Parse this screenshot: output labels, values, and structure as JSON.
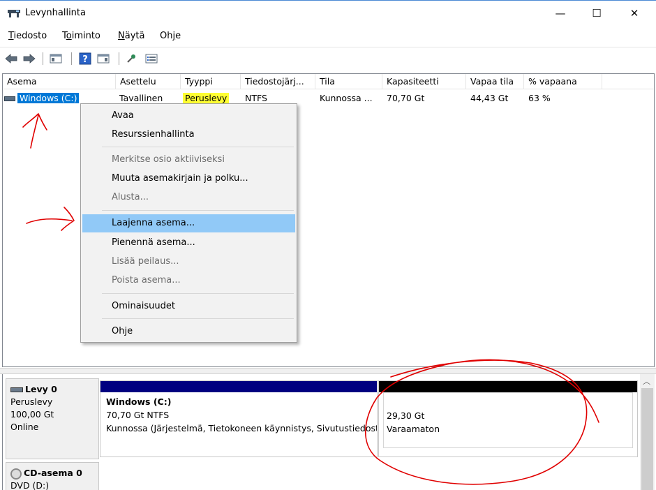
{
  "window": {
    "title": "Levynhallinta",
    "controls": {
      "minimize": "—",
      "maximize": "☐",
      "close": "✕"
    }
  },
  "menu": [
    {
      "label": "Tiedosto",
      "mnemonic_index": 0
    },
    {
      "label": "Toiminto",
      "mnemonic_index": 1
    },
    {
      "label": "Näytä",
      "mnemonic_index": 0
    },
    {
      "label": "Ohje",
      "mnemonic_index": 2
    }
  ],
  "toolbar": {
    "icons": [
      "back-icon",
      "forward-icon",
      "console-tree-icon",
      "help-icon",
      "action-pane-icon",
      "properties-icon",
      "list-view-icon"
    ]
  },
  "volume_table": {
    "columns": [
      "Asema",
      "Asettelu",
      "Tyyppi",
      "Tiedostojärj...",
      "Tila",
      "Kapasiteetti",
      "Vapaa tila",
      "% vapaana"
    ],
    "rows": [
      {
        "name": "Windows (C:)",
        "layout": "Tavallinen",
        "type": "Peruslevy",
        "filesystem": "NTFS",
        "status": "Kunnossa ...",
        "capacity": "70,70 Gt",
        "free": "44,43 Gt",
        "percent_free": "63 %"
      }
    ]
  },
  "context_menu": {
    "items": [
      {
        "label": "Avaa",
        "enabled": true
      },
      {
        "label": "Resurssienhallinta",
        "enabled": true
      },
      {
        "label": "Merkitse osio aktiiviseksi",
        "enabled": false
      },
      {
        "label": "Muuta asemakirjain ja polku...",
        "enabled": true
      },
      {
        "label": "Alusta...",
        "enabled": false
      },
      {
        "label": "Laajenna asema...",
        "enabled": true,
        "highlighted": true
      },
      {
        "label": "Pienennä asema...",
        "enabled": true
      },
      {
        "label": "Lisää peilaus...",
        "enabled": false
      },
      {
        "label": "Poista asema...",
        "enabled": false
      },
      {
        "label": "Ominaisuudet",
        "enabled": true
      },
      {
        "label": "Ohje",
        "enabled": true
      }
    ]
  },
  "disks": [
    {
      "name": "Levy 0",
      "type": "Peruslevy",
      "size": "100,00 Gt",
      "state": "Online",
      "partitions": [
        {
          "name": "Windows  (C:)",
          "size_fs": "70,70 Gt NTFS",
          "status": "Kunnossa (Järjestelmä, Tietokoneen käynnistys, Sivutustiedosto",
          "bar_color": "#000080"
        },
        {
          "name": "",
          "size_fs": "29,30 Gt",
          "status": "Varaamaton",
          "bar_color": "#000000"
        }
      ]
    },
    {
      "name": "CD-asema 0",
      "type": "DVD (D:)"
    }
  ],
  "colors": {
    "selection": "#0078d7",
    "menu_highlight": "#91c9f7",
    "annotation_red": "#e00000",
    "highlighter_yellow": "#ffff33",
    "primary_partition": "#000080",
    "unallocated": "#000000"
  }
}
